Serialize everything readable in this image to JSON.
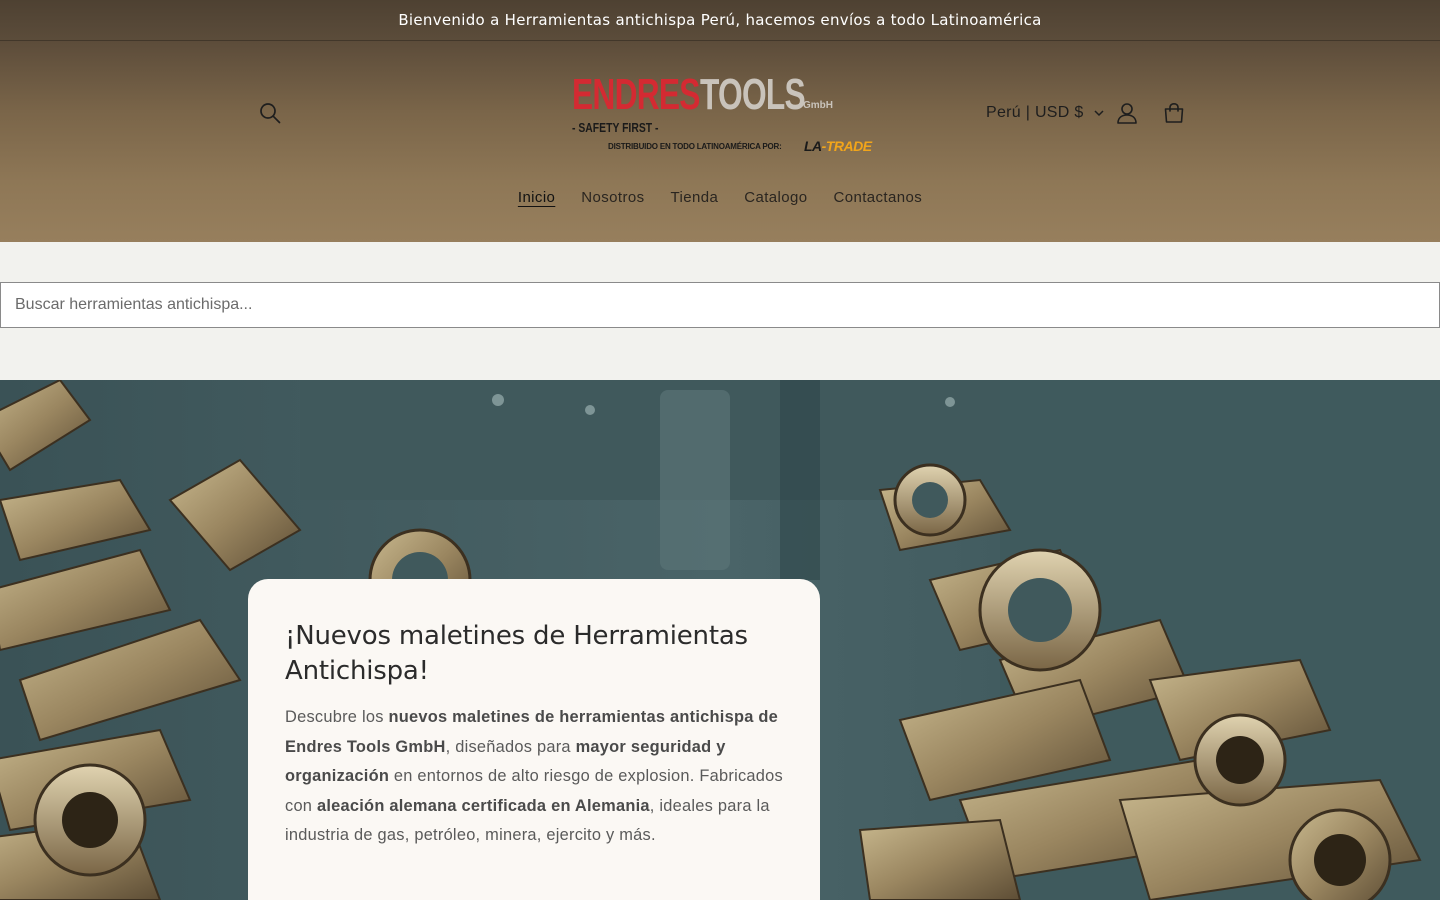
{
  "announcement": {
    "text": "Bienvenido a Herramientas antichispa Perú, hacemos envíos a todo Latinoamérica"
  },
  "header": {
    "logo": {
      "brand_red": "ENDRES",
      "brand_grey": "TOOLS",
      "suffix": "GmbH",
      "tagline": "- SAFETY FIRST -",
      "distributor": "DISTRIBUIDO EN TODO LATINOAMÉRICA POR:",
      "partner_prefix": "LA",
      "partner_suffix": "-TRADE"
    },
    "locale": "Perú | USD $",
    "icons": {
      "search": "search-icon",
      "account": "account-icon",
      "cart": "cart-icon",
      "chevron": "chevron-down-icon"
    }
  },
  "nav": {
    "items": [
      {
        "label": "Inicio",
        "active": true
      },
      {
        "label": "Nosotros",
        "active": false
      },
      {
        "label": "Tienda",
        "active": false
      },
      {
        "label": "Catalogo",
        "active": false
      },
      {
        "label": "Contactanos",
        "active": false
      }
    ]
  },
  "search": {
    "placeholder": "Buscar herramientas antichispa...",
    "value": ""
  },
  "hero": {
    "title": "¡Nuevos maletines de Herramientas Antichispa!",
    "body": {
      "p1": "Descubre los ",
      "b1": "nuevos maletines de herramientas antichispa de Endres Tools GmbH",
      "p2": ", diseñados para ",
      "b2": "mayor seguridad y organización",
      "p3": " en entornos de alto riesgo de explosion. Fabricados con ",
      "b3": "aleación alemana certificada en Alemania",
      "p4": ", ideales para la industria de gas, petróleo, minera, ejercito y más."
    }
  },
  "colors": {
    "announcement_bg": "#52453a",
    "header_gradient_top": "#5c4c3a",
    "header_gradient_bottom": "#977f5d",
    "brand_red": "#d42a32",
    "partner_orange": "#f2a51a",
    "page_bg": "#f2f2ee",
    "card_bg": "#fbf8f4"
  }
}
